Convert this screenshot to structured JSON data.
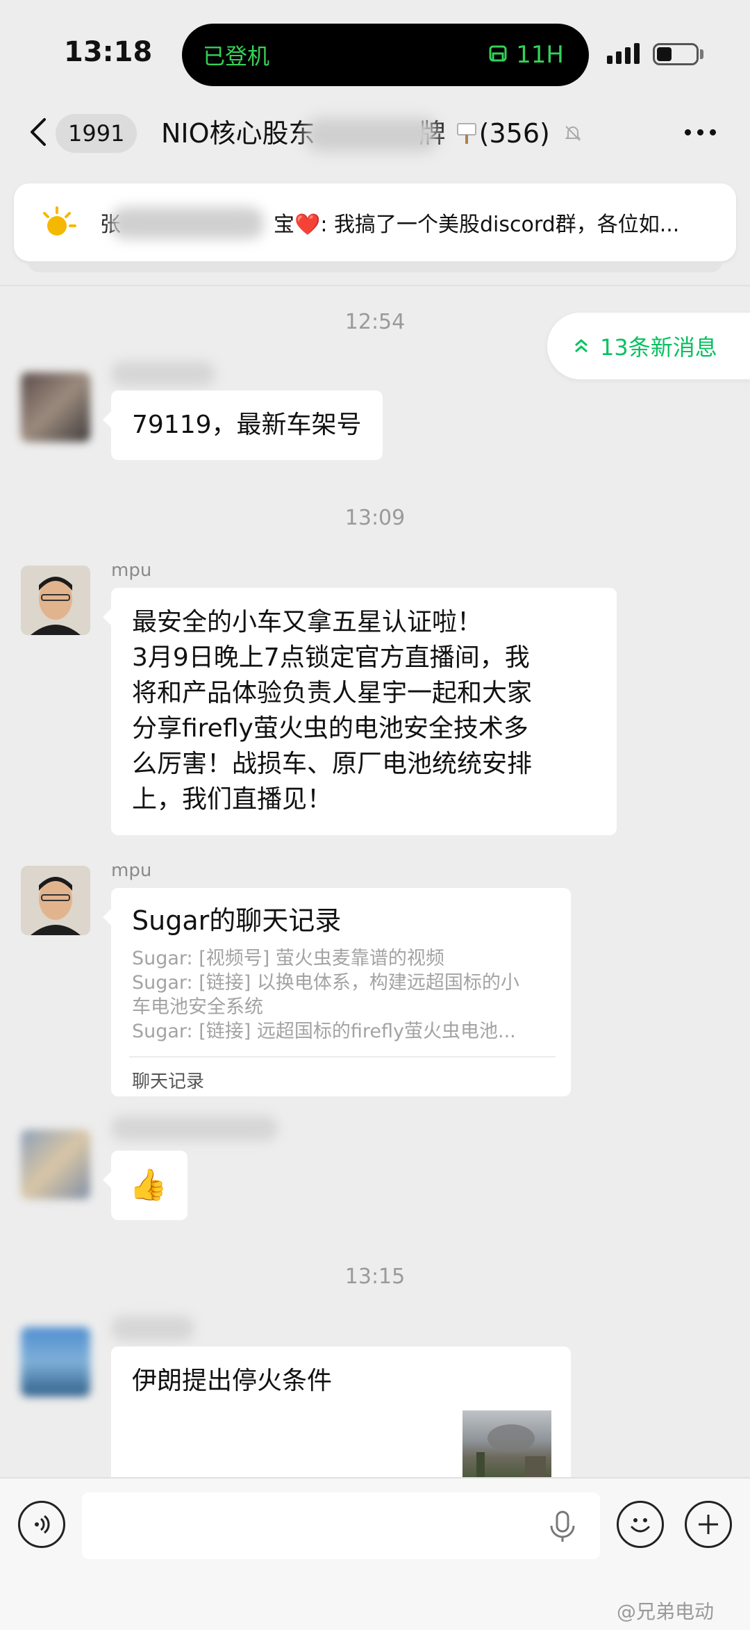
{
  "status_bar": {
    "time": "13:18",
    "island_text": "已登机",
    "island_timer": "11H"
  },
  "nav": {
    "unread_count": "1991",
    "title": "NIO核心股东",
    "title_suffix": "牌",
    "member_count": "(356)"
  },
  "pinned": {
    "prefix": "张",
    "text_after_blur": "宝❤️: 我搞了一个美股discord群，各位如..."
  },
  "new_messages_label": "13条新消息",
  "chat": {
    "time_1": "12:54",
    "msg_1": "79119，最新车架号",
    "time_2": "13:09",
    "sender_mpu": "mpu",
    "msg_2_lines": [
      "最安全的小车又拿五星认证啦！",
      "3月9日晚上7点锁定官方直播间，我",
      "将和产品体验负责人星宇一起和大家",
      "分享firefly萤火虫的电池安全技术多",
      "么厉害！战损车、原厂电池统统安排",
      "上，我们直播见！"
    ],
    "record": {
      "title": "Sugar的聊天记录",
      "lines": [
        "Sugar: [视频号] 萤火虫麦靠谱的视频",
        "Sugar: [链接] 以换电体系，构建远超国标的小",
        "车电池安全系统",
        "Sugar: [链接] 远超国标的firefly萤火虫电池..."
      ],
      "footer": "聊天记录"
    },
    "msg_4": "👍",
    "time_3": "13:15",
    "msg_5": "伊朗提出停火条件"
  },
  "watermark": "@兄弟电动",
  "colors": {
    "accent": "#07c160",
    "background": "#ededed",
    "bubble": "#ffffff"
  }
}
